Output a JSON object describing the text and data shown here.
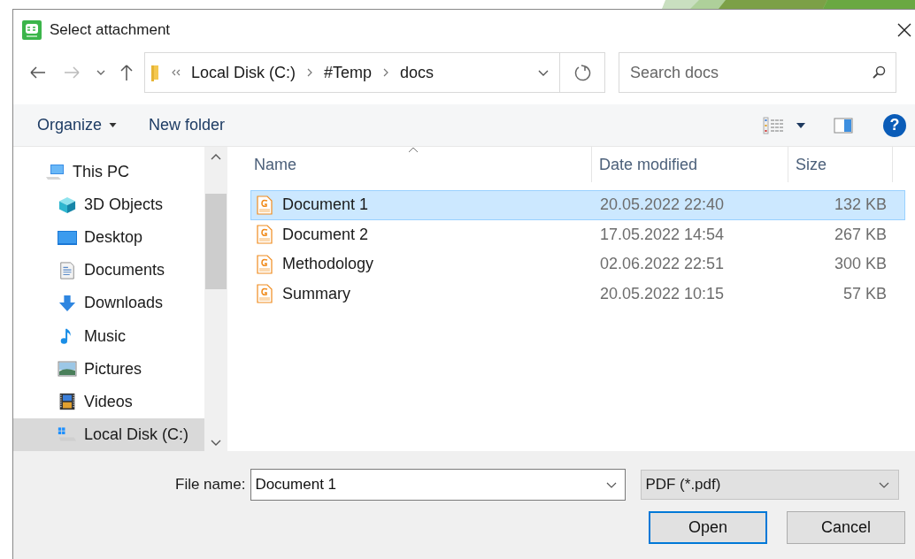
{
  "window": {
    "title": "Select attachment"
  },
  "address": {
    "crumbs": [
      "Local Disk (C:)",
      "#Temp",
      "docs"
    ]
  },
  "search": {
    "placeholder": "Search docs"
  },
  "toolbar": {
    "organize": "Organize",
    "new_folder": "New folder",
    "help": "?"
  },
  "sidebar": {
    "items": [
      {
        "label": "This PC",
        "kind": "computer",
        "selected": false,
        "children": [
          {
            "label": "3D Objects",
            "kind": "cube",
            "selected": false
          },
          {
            "label": "Desktop",
            "kind": "desktop",
            "selected": false
          },
          {
            "label": "Documents",
            "kind": "documents",
            "selected": false
          },
          {
            "label": "Downloads",
            "kind": "downloads",
            "selected": false
          },
          {
            "label": "Music",
            "kind": "music",
            "selected": false
          },
          {
            "label": "Pictures",
            "kind": "pictures",
            "selected": false
          },
          {
            "label": "Videos",
            "kind": "videos",
            "selected": false
          },
          {
            "label": "Local Disk (C:)",
            "kind": "drive",
            "selected": true
          }
        ]
      }
    ]
  },
  "table": {
    "columns": [
      "Name",
      "Date modified",
      "Size"
    ],
    "rows": [
      {
        "name": "Document 1",
        "date": "20.05.2022 22:40",
        "size": "132 KB",
        "selected": true
      },
      {
        "name": "Document 2",
        "date": "17.05.2022 14:54",
        "size": "267 KB",
        "selected": false
      },
      {
        "name": "Methodology",
        "date": "02.06.2022 22:51",
        "size": "300 KB",
        "selected": false
      },
      {
        "name": "Summary",
        "date": "20.05.2022 10:15",
        "size": "57 KB",
        "selected": false
      }
    ]
  },
  "footer": {
    "file_name_label": "File name:",
    "file_name": "Document 1",
    "filter": "PDF (*.pdf)",
    "buttons": [
      {
        "label": "Open",
        "default": true
      },
      {
        "label": "Cancel",
        "default": false
      }
    ]
  }
}
